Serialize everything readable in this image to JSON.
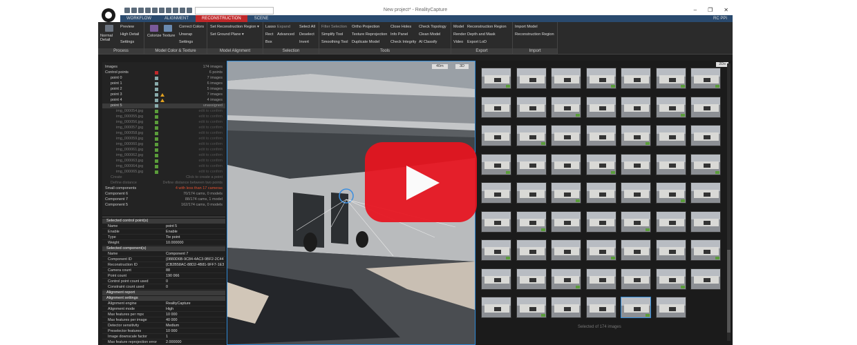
{
  "window": {
    "title": "New project* - RealityCapture",
    "search_placeholder": "",
    "user": "RC PPI",
    "min": "–",
    "max": "❐",
    "close": "✕"
  },
  "tabs": [
    "WORKFLOW",
    "ALIGNMENT",
    "RECONSTRUCTION",
    "SCENE"
  ],
  "ribbon": {
    "process": {
      "name": "Process",
      "big": "Normal Detail",
      "items": [
        "Preview",
        "High Detail",
        "Settings"
      ]
    },
    "color": {
      "name": "Model Color & Texture",
      "colorize": "Colorize",
      "texture": "Texture",
      "items": [
        "Correct Colors",
        "Unwrap",
        "Settings"
      ]
    },
    "alignment": {
      "name": "Model Alignment",
      "items": [
        "Set Reconstruction Region ▾",
        "Set Ground Plane ▾"
      ]
    },
    "selection": {
      "name": "Selection",
      "items": [
        "Lasso",
        "Rect",
        "Box",
        "Expand",
        "Advanced",
        "Select All",
        "Deselect",
        "Invert"
      ]
    },
    "tools": {
      "name": "Tools",
      "items": [
        "Filter Selection",
        "Simplify Tool",
        "Smoothing Tool",
        "Ortho Projection",
        "Texture Reprojection",
        "Duplicate Model",
        "Close Holes",
        "Info Panel",
        "Check Integrity",
        "Check Topology",
        "Clean Model",
        "AI Classify"
      ]
    },
    "export": {
      "name": "Export",
      "items": [
        "Model",
        "Render",
        "Video",
        "Reconstruction Region",
        "Depth and Mask",
        "Export LoD"
      ]
    },
    "import": {
      "name": "Import",
      "items": [
        "Import Model",
        "Reconstruction Region"
      ]
    }
  },
  "tree": [
    {
      "label": "Images",
      "value": "174 images",
      "indent": 0
    },
    {
      "label": "Control points",
      "value": "6 points",
      "indent": 0
    },
    {
      "label": "point 0",
      "value": "7 images",
      "indent": 1
    },
    {
      "label": "point 1",
      "value": "6 images",
      "indent": 1
    },
    {
      "label": "point 2",
      "value": "5 images",
      "indent": 1
    },
    {
      "label": "point 3",
      "value": "7 images",
      "indent": 1
    },
    {
      "label": "point 4",
      "value": "4 images",
      "indent": 1
    },
    {
      "label": "point 5",
      "value": "unassigned",
      "indent": 1
    },
    {
      "label": "img_000054.jpg",
      "value": "edit to confirm",
      "indent": 2
    },
    {
      "label": "img_000055.jpg",
      "value": "edit to confirm",
      "indent": 2
    },
    {
      "label": "img_000056.jpg",
      "value": "edit to confirm",
      "indent": 2
    },
    {
      "label": "img_000057.jpg",
      "value": "edit to confirm",
      "indent": 2
    },
    {
      "label": "img_000058.jpg",
      "value": "edit to confirm",
      "indent": 2
    },
    {
      "label": "img_000059.jpg",
      "value": "edit to confirm",
      "indent": 2
    },
    {
      "label": "img_000060.jpg",
      "value": "edit to confirm",
      "indent": 2
    },
    {
      "label": "img_000061.jpg",
      "value": "edit to confirm",
      "indent": 2
    },
    {
      "label": "img_000062.jpg",
      "value": "edit to confirm",
      "indent": 2
    },
    {
      "label": "img_000063.jpg",
      "value": "edit to confirm",
      "indent": 2
    },
    {
      "label": "img_000064.jpg",
      "value": "edit to confirm",
      "indent": 2
    },
    {
      "label": "img_000065.jpg",
      "value": "edit to confirm",
      "indent": 2
    },
    {
      "label": "Create",
      "value": "Click to create a point",
      "indent": 1
    },
    {
      "label": "Define distance",
      "value": "Define distance between two points",
      "indent": 1
    },
    {
      "label": "Small components",
      "value": "4 with less than 17 cameras",
      "indent": 0
    },
    {
      "label": "Component 6",
      "value": "70/174 cams, 0 models",
      "indent": 0
    },
    {
      "label": "Component 7",
      "value": "88/174 cams, 1 model",
      "indent": 0
    },
    {
      "label": "Component 5",
      "value": "162/174 cams, 0 models",
      "indent": 0
    }
  ],
  "props": {
    "cp_header": "Selected control point(s)",
    "cp_rows": [
      {
        "k": "Name",
        "v": "point 5"
      },
      {
        "k": "Enable",
        "v": "Enable"
      },
      {
        "k": "Type",
        "v": "Tie point"
      },
      {
        "k": "Weight",
        "v": "10.000000"
      }
    ],
    "comp_header": "Selected component(s)",
    "comp_rows": [
      {
        "k": "Name",
        "v": "Component 7"
      },
      {
        "k": "Component ID",
        "v": "{0880D6B-9C84-4AC3-9BF2-2C447..."
      },
      {
        "k": "Reconstruction ID",
        "v": "{CB2B58AC-88D2-4B81-9FF7-1E3A4..."
      },
      {
        "k": "Camera count",
        "v": "88"
      },
      {
        "k": "Point count",
        "v": "190 066"
      },
      {
        "k": "Control point count used",
        "v": "0"
      },
      {
        "k": "Constraint count used",
        "v": "0"
      }
    ],
    "report": "Alignment report",
    "settings": "Alignment settings",
    "settings_rows": [
      {
        "k": "Alignment engine",
        "v": "RealityCapture"
      },
      {
        "k": "Alignment mode",
        "v": "High"
      },
      {
        "k": "Max features per mpx",
        "v": "10 000"
      },
      {
        "k": "Max features per image",
        "v": "40 000"
      },
      {
        "k": "Detector sensitivity",
        "v": "Medium"
      },
      {
        "k": "Preselector features",
        "v": "10 000"
      },
      {
        "k": "Image downscale factor",
        "v": "1"
      },
      {
        "k": "Max feature reprojection error",
        "v": "2.000000"
      }
    ]
  },
  "viewport": {
    "left_tag": "40m",
    "right_tag": "3D"
  },
  "gallery": {
    "tag": "2Ds",
    "count_text": "Selected of 174 images",
    "rows": 9,
    "cols": 7,
    "last_row": 6
  }
}
